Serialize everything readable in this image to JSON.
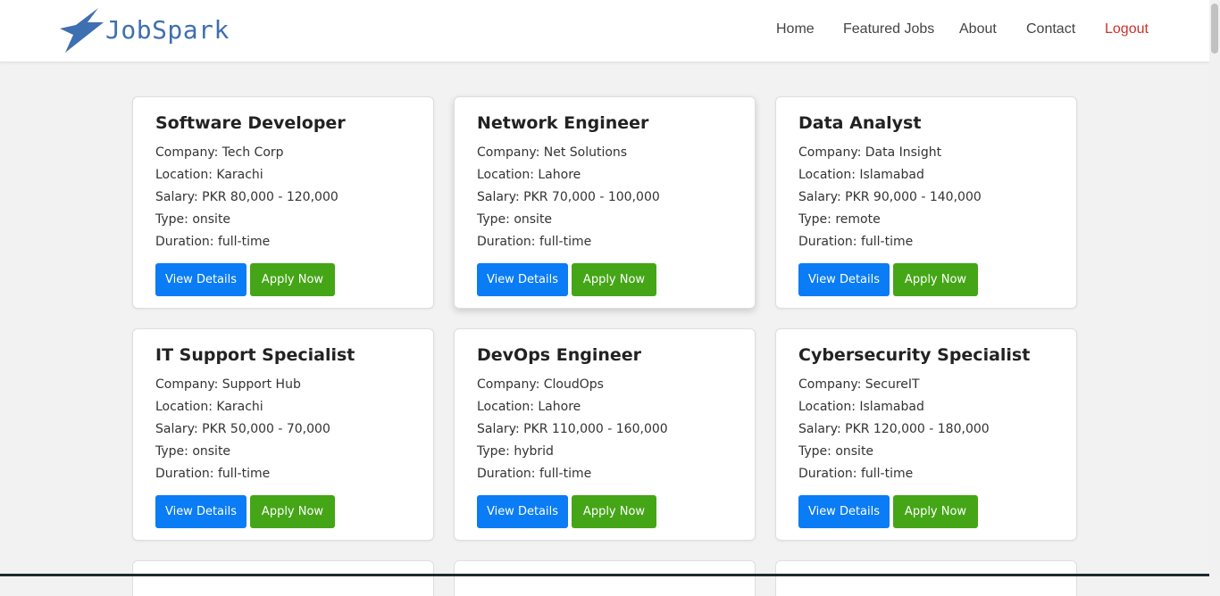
{
  "brand": {
    "name": "JobSpark",
    "accent": "#3e6fb0"
  },
  "nav": {
    "home": "Home",
    "featured": "Featured Jobs",
    "about": "About",
    "contact": "Contact",
    "logout": "Logout"
  },
  "jobs": [
    {
      "title": "Software Developer",
      "company": "Company: Tech Corp",
      "location": "Location: Karachi",
      "salary": "Salary: PKR 80,000 - 120,000",
      "type": "Type: onsite",
      "duration": "Duration: full-time",
      "view_label": "View Details",
      "apply_label": "Apply Now"
    },
    {
      "title": "Network Engineer",
      "company": "Company: Net Solutions",
      "location": "Location: Lahore",
      "salary": "Salary: PKR 70,000 - 100,000",
      "type": "Type: onsite",
      "duration": "Duration: full-time",
      "view_label": "View Details",
      "apply_label": "Apply Now"
    },
    {
      "title": "Data Analyst",
      "company": "Company: Data Insight",
      "location": "Location: Islamabad",
      "salary": "Salary: PKR 90,000 - 140,000",
      "type": "Type: remote",
      "duration": "Duration: full-time",
      "view_label": "View Details",
      "apply_label": "Apply Now"
    },
    {
      "title": "IT Support Specialist",
      "company": "Company: Support Hub",
      "location": "Location: Karachi",
      "salary": "Salary: PKR 50,000 - 70,000",
      "type": "Type: onsite",
      "duration": "Duration: full-time",
      "view_label": "View Details",
      "apply_label": "Apply Now"
    },
    {
      "title": "DevOps Engineer",
      "company": "Company: CloudOps",
      "location": "Location: Lahore",
      "salary": "Salary: PKR 110,000 - 160,000",
      "type": "Type: hybrid",
      "duration": "Duration: full-time",
      "view_label": "View Details",
      "apply_label": "Apply Now"
    },
    {
      "title": "Cybersecurity Specialist",
      "company": "Company: SecureIT",
      "location": "Location: Islamabad",
      "salary": "Salary: PKR 120,000 - 180,000",
      "type": "Type: onsite",
      "duration": "Duration: full-time",
      "view_label": "View Details",
      "apply_label": "Apply Now"
    }
  ],
  "colors": {
    "view_button": "#0a7cf5",
    "apply_button": "#44a616",
    "logout": "#d0312d"
  },
  "icons": {
    "logo": "lightning-bolt-icon"
  }
}
